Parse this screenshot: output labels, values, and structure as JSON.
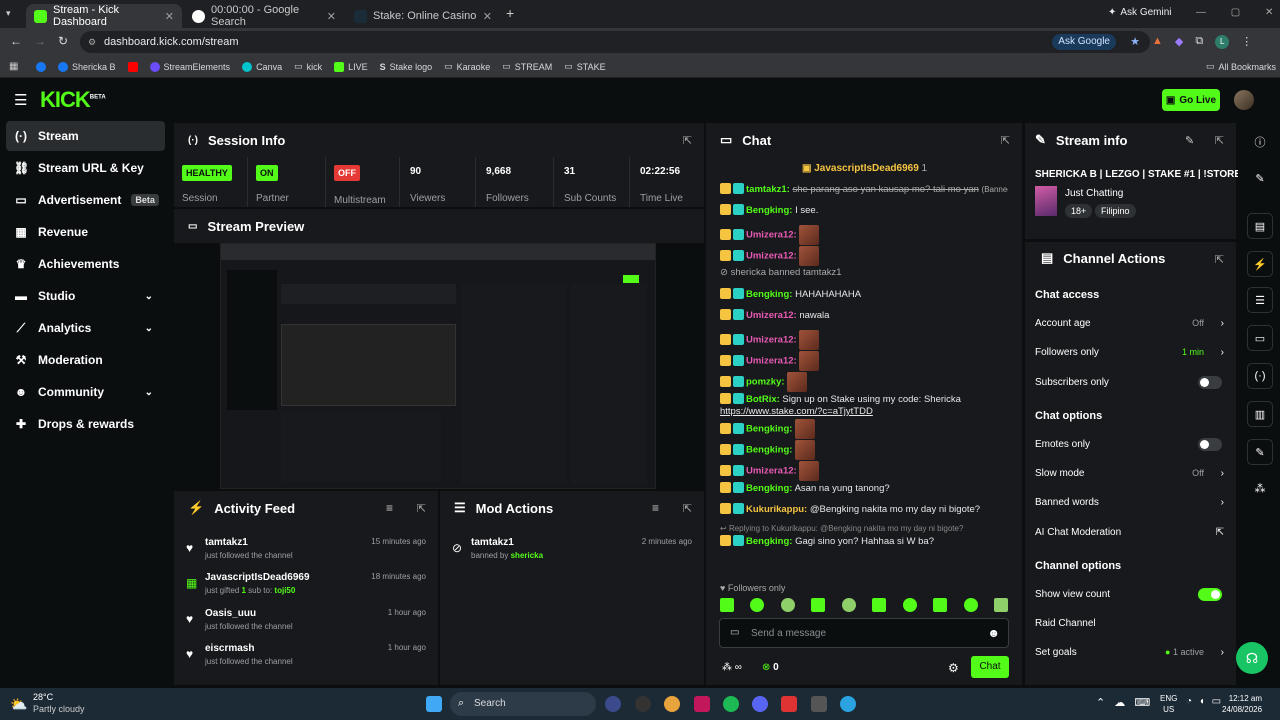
{
  "browser": {
    "tabs": [
      {
        "title": "Stream - Kick Dashboard",
        "close": "✕"
      },
      {
        "title": "00:00:00 - Google Search",
        "close": "✕"
      },
      {
        "title": "Stake: Online Casino & Sports B",
        "close": "✕"
      }
    ],
    "new_tab": "+",
    "ask_gemini": "Ask Gemini",
    "url": "dashboard.kick.com/stream",
    "ask_google": "Ask Google",
    "bookmarks": [
      "Shericka B",
      "StreamElements",
      "Canva",
      "kick",
      "LIVE",
      "Stake logo",
      "Karaoke",
      "STREAM",
      "STAKE"
    ],
    "all_bookmarks": "All Bookmarks"
  },
  "kick": {
    "logo": "KICK",
    "beta": "BETA",
    "go_live": "Go Live"
  },
  "sidebar": {
    "items": [
      {
        "label": "Stream",
        "icon": "(·)"
      },
      {
        "label": "Stream URL & Key",
        "icon": "🔗"
      },
      {
        "label": "Advertisement",
        "icon": "▭",
        "badge": "Beta"
      },
      {
        "label": "Revenue",
        "icon": "▦"
      },
      {
        "label": "Achievements",
        "icon": "🏆"
      },
      {
        "label": "Studio",
        "icon": "▬"
      },
      {
        "label": "Analytics",
        "icon": "📈"
      },
      {
        "label": "Moderation",
        "icon": "🔨"
      },
      {
        "label": "Community",
        "icon": "👥"
      },
      {
        "label": "Drops & rewards",
        "icon": "🎁"
      }
    ]
  },
  "session": {
    "title": "Session Info",
    "stats": [
      {
        "badge": "HEALTHY",
        "label": "Session"
      },
      {
        "badge": "ON",
        "label": "Partner"
      },
      {
        "badge": "OFF",
        "label": "Multistream"
      },
      {
        "value": "90",
        "label": "Viewers"
      },
      {
        "value": "9,668",
        "label": "Followers"
      },
      {
        "value": "31",
        "label": "Sub Counts"
      },
      {
        "value": "02:22:56",
        "label": "Time Live"
      }
    ]
  },
  "preview": {
    "title": "Stream Preview"
  },
  "activity": {
    "title": "Activity Feed",
    "items": [
      {
        "name": "tamtakz1",
        "sub": "just followed the channel",
        "time": "15 minutes ago"
      },
      {
        "name": "JavascriptIsDead6969",
        "sub_pre": "just gifted",
        "sub_count": "1",
        "sub_mid": "sub to:",
        "sub_user": "toji50",
        "time": "18 minutes ago"
      },
      {
        "name": "Oasis_uuu",
        "sub": "just followed the channel",
        "time": "1 hour ago"
      },
      {
        "name": "eiscrmash",
        "sub": "just followed the channel",
        "time": "1 hour ago"
      }
    ]
  },
  "mod": {
    "title": "Mod Actions",
    "items": [
      {
        "name": "tamtakz1",
        "sub": "banned by",
        "by": "shericka",
        "time": "2 minutes ago"
      }
    ]
  },
  "chat": {
    "title": "Chat",
    "pinned": "JavascriptIsDead6969",
    "pinned_count": "1",
    "lines": [
      {
        "user": "tamtakz1:",
        "text": "she parang aso yan kausap mo? tali mo yan",
        "suffix": "(Banned)",
        "color": "#53fc18",
        "strike": true
      },
      {
        "user": "Bengking:",
        "text": "I see.",
        "color": "#53fc18"
      },
      {
        "user": "Umizera12:",
        "text": "",
        "color": "#e85ab5",
        "emote": true
      },
      {
        "user": "Umizera12:",
        "text": "",
        "color": "#e85ab5",
        "emote": true
      },
      {
        "system": "shericka banned tamtakz1"
      },
      {
        "user": "Bengking:",
        "text": "HAHAHAHAHA",
        "color": "#53fc18"
      },
      {
        "user": "Umizera12:",
        "text": "nawala",
        "color": "#e85ab5"
      },
      {
        "user": "Umizera12:",
        "text": "",
        "color": "#e85ab5",
        "emote": true
      },
      {
        "user": "Umizera12:",
        "text": "",
        "color": "#e85ab5",
        "emote": true
      },
      {
        "user": "pomzky:",
        "text": "",
        "color": "#53fc18",
        "emote": true
      },
      {
        "user": "BotRix:",
        "text": "Sign up on Stake using my code: Shericka",
        "color": "#53fc18"
      },
      {
        "link": "https://www.stake.com/?c=aTjytTDD"
      },
      {
        "user": "Bengking:",
        "text": "",
        "color": "#53fc18",
        "emote": true
      },
      {
        "user": "Bengking:",
        "text": "",
        "color": "#53fc18",
        "emote": true
      },
      {
        "user": "Umizera12:",
        "text": "",
        "color": "#e85ab5",
        "emote": true
      },
      {
        "user": "Bengking:",
        "text": "Asan na yung tanong?",
        "color": "#53fc18"
      },
      {
        "user": "Kukurikappu:",
        "text": "@Bengking nakita mo my day ni bigote?",
        "color": "#f5c542"
      },
      {
        "reply": "Replying to Kukurikappu: @Bengking nakita mo my day ni bigote?"
      },
      {
        "user": "Bengking:",
        "text": "Gagi sino yon? Hahhaa si W ba?",
        "color": "#53fc18"
      }
    ],
    "followers_only": "Followers only",
    "placeholder": "Send a message",
    "points": "∞",
    "coins": "0",
    "send": "Chat"
  },
  "stream_info": {
    "title": "Stream info",
    "stream_title": "SHERICKA B | LEZGO | STAKE #1 | !STORE",
    "category": "Just Chatting",
    "tags": [
      "18+",
      "Filipino"
    ]
  },
  "channel_actions": {
    "title": "Channel Actions",
    "chat_access": "Chat access",
    "account_age": {
      "label": "Account age",
      "value": "Off"
    },
    "followers_only": {
      "label": "Followers only",
      "value": "1 min"
    },
    "subscribers_only": {
      "label": "Subscribers only"
    },
    "chat_options": "Chat options",
    "emotes_only": {
      "label": "Emotes only"
    },
    "slow_mode": {
      "label": "Slow mode",
      "value": "Off"
    },
    "banned_words": {
      "label": "Banned words"
    },
    "ai_mod": {
      "label": "AI Chat Moderation"
    },
    "channel_options": "Channel options",
    "show_view_count": {
      "label": "Show view count"
    },
    "raid": {
      "label": "Raid Channel"
    },
    "goals": {
      "label": "Set goals",
      "value": "1 active"
    }
  },
  "taskbar": {
    "weather_temp": "28°C",
    "weather_desc": "Partly cloudy",
    "search": "Search",
    "lang1": "ENG",
    "lang2": "US",
    "time": "12:12 am",
    "date": "24/08/2026"
  },
  "colors": {
    "accent": "#53fc18"
  }
}
